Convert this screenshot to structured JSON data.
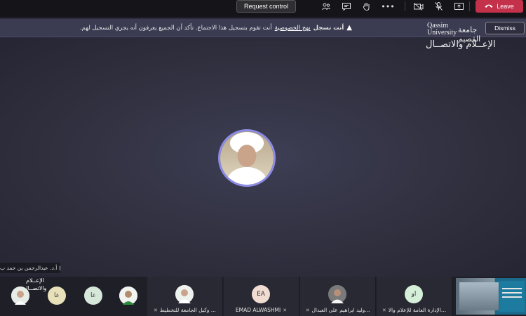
{
  "toolbar": {
    "request_control_label": "Request control",
    "leave_label": "Leave",
    "icons": [
      "participants-icon",
      "chat-icon",
      "raise-hand-icon",
      "more-icon",
      "camera-off-icon",
      "mic-off-icon",
      "share-icon",
      "leave-phone-icon"
    ]
  },
  "banner": {
    "you_are_recording": "أنت تسجل",
    "privacy_link": "نهج الخصوصية",
    "message": "أنت تقوم بتسجيل هذا الاجتماع. تأكد أن الجميع يعرفون أنه يجري التسجيل لهم.",
    "dismiss_label": "Dismiss"
  },
  "logo": {
    "english": "Qassim University",
    "arabic_uni": "جامعة القصيم",
    "arabic_dept": "الإعــلام والاتصــال"
  },
  "speaker": {
    "name": "أ.د. عبدالرحمن بن حمد ب"
  },
  "participants": [
    {
      "name": "وكيل الجامعة للتخطيط ...",
      "type": "photo"
    },
    {
      "name": "EMAD ALWASHMI",
      "initials": "EA"
    },
    {
      "name": "وليد ابراهيم على العبدال...",
      "type": "photo"
    },
    {
      "name": "الإدارة العامة للإعلام والا...",
      "initials": "او"
    }
  ],
  "mini_avatars": [
    {
      "initials": "عا"
    },
    {
      "initials": "عا"
    }
  ],
  "colors": {
    "leave": "#c4314b",
    "ring": "#8d8ce8",
    "banner": "#3b3b52"
  }
}
